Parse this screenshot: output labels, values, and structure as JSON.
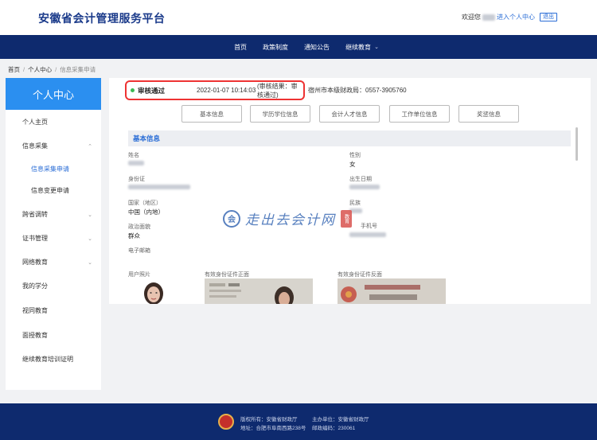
{
  "header": {
    "site_title": "安徽省会计管理服务平台",
    "welcome": "欢迎您",
    "enter_center": "进入个人中心",
    "logout": "退出"
  },
  "nav": {
    "items": [
      "首页",
      "政策制度",
      "通知公告",
      "继续教育"
    ]
  },
  "breadcrumb": [
    "首页",
    "个人中心",
    "信息采集申请"
  ],
  "sidebar": {
    "title": "个人中心",
    "items": [
      {
        "label": "个人主页"
      },
      {
        "label": "信息采集"
      },
      {
        "label": "信息采集申请"
      },
      {
        "label": "信息变更申请"
      },
      {
        "label": "跨省调转"
      },
      {
        "label": "证书管理"
      },
      {
        "label": "网络教育"
      },
      {
        "label": "我的学分"
      },
      {
        "label": "视同教育"
      },
      {
        "label": "面授教育"
      },
      {
        "label": "继续教育培训证明"
      }
    ]
  },
  "status": {
    "label": "审核通过",
    "time": "2022-01-07 10:14:03",
    "result": "(审核结果：审核通过)",
    "org": "宿州市本级财政局：0557-3905760"
  },
  "tabs": [
    "基本信息",
    "学历学位信息",
    "会计人才信息",
    "工作单位信息",
    "奖惩信息"
  ],
  "section_title": "基本信息",
  "fields": {
    "name_label": "姓名",
    "gender_label": "性别",
    "gender_value": "女",
    "idcard_label": "身份证",
    "birth_label": "出生日期",
    "country_label": "国家（地区）",
    "country_value": "中国（内地）",
    "nation_label": "民族",
    "politics_label": "政治面貌",
    "politics_value": "群众",
    "phone_label": "手机号",
    "email_label": "电子邮箱",
    "photo_label": "用户照片",
    "id_front_label": "有效身份证件正面",
    "id_back_label": "有效身份证件反面"
  },
  "watermark": {
    "text": "走出去会计网",
    "seal": "教育"
  },
  "footer": {
    "copyright": "版权所有：安徽省财政厅",
    "host": "主办单位：安徽省财政厅",
    "address": "地址：合肥市阜南西路238号",
    "postcode": "邮政编码：230061"
  },
  "colors": {
    "primary": "#0e2a6e",
    "accent": "#2b8ff0",
    "link": "#2a6dd6",
    "status_border": "#e33333",
    "status_dot": "#3cba54"
  }
}
